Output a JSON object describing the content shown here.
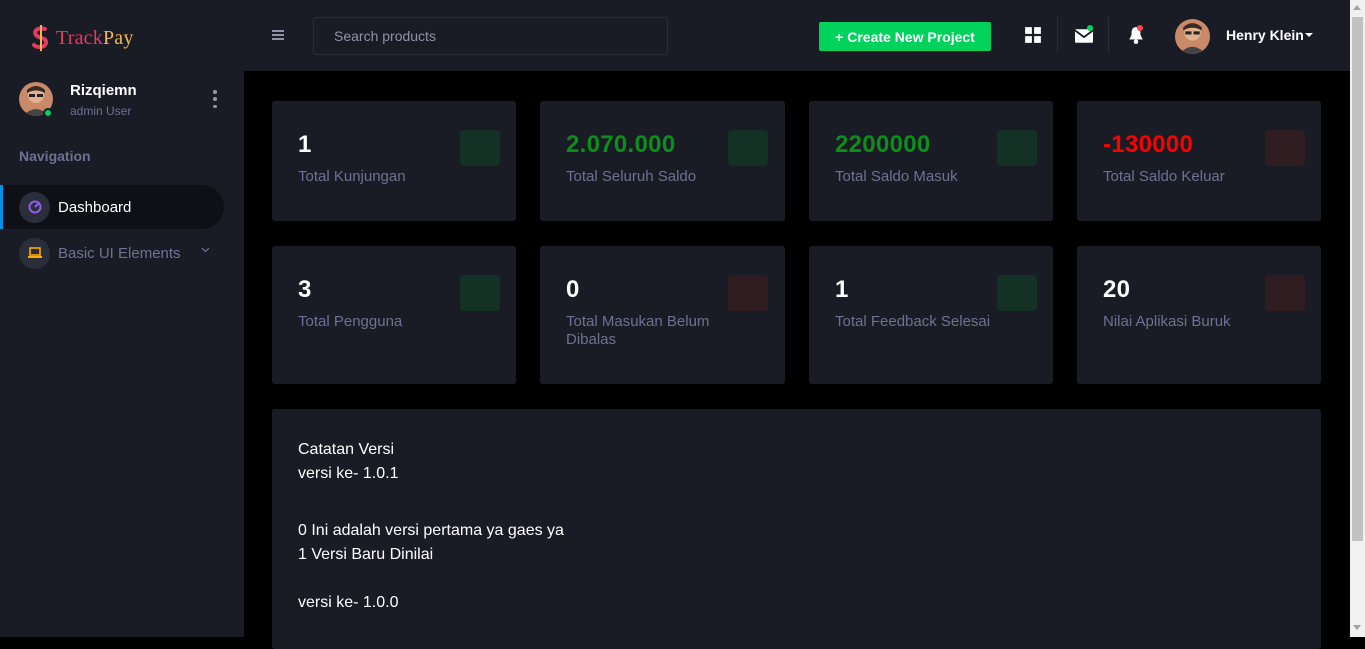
{
  "brand": {
    "part1": "Track",
    "part2": "Pay"
  },
  "sidebar": {
    "profile": {
      "name": "Rizqiemn",
      "role": "admin User"
    },
    "nav_title": "Navigation",
    "items": [
      {
        "label": "Dashboard",
        "icon": "speedometer-icon",
        "active": true
      },
      {
        "label": "Basic UI Elements",
        "icon": "laptop-icon",
        "active": false
      }
    ]
  },
  "topbar": {
    "search_placeholder": "Search products",
    "create_label": "+ Create New Project",
    "user_name": "Henry Klein"
  },
  "stats": [
    {
      "value": "1",
      "label": "Total Kunjungan",
      "value_color": "#ffffff",
      "icon_bg": "#143125"
    },
    {
      "value": "2.070.000",
      "label": "Total Seluruh Saldo",
      "value_color": "#0c8f1a",
      "icon_bg": "#143125"
    },
    {
      "value": "2200000",
      "label": "Total Saldo Masuk",
      "value_color": "#0c8f1a",
      "icon_bg": "#143125"
    },
    {
      "value": "-130000",
      "label": "Total Saldo Keluar",
      "value_color": "#fc0000",
      "icon_bg": "#301d22"
    },
    {
      "value": "3",
      "label": "Total Pengguna",
      "value_color": "#ffffff",
      "icon_bg": "#143125"
    },
    {
      "value": "0",
      "label": "Total Masukan Belum Dibalas",
      "value_color": "#ffffff",
      "icon_bg": "#301d22"
    },
    {
      "value": "1",
      "label": "Total Feedback Selesai",
      "value_color": "#ffffff",
      "icon_bg": "#143125"
    },
    {
      "value": "20",
      "label": "Nilai Aplikasi Buruk",
      "value_color": "#ffffff",
      "icon_bg": "#301d22"
    }
  ],
  "notes": {
    "title": "Catatan Versi",
    "lines": [
      "versi ke- 1.0.1",
      "0 Ini adalah versi pertama ya gaes ya",
      "1 Versi Baru Dinilai",
      "versi ke- 1.0.0"
    ]
  },
  "colors": {
    "accent_green": "#00d25b",
    "accent_blue": "#0090e7",
    "danger": "#fc424a"
  }
}
